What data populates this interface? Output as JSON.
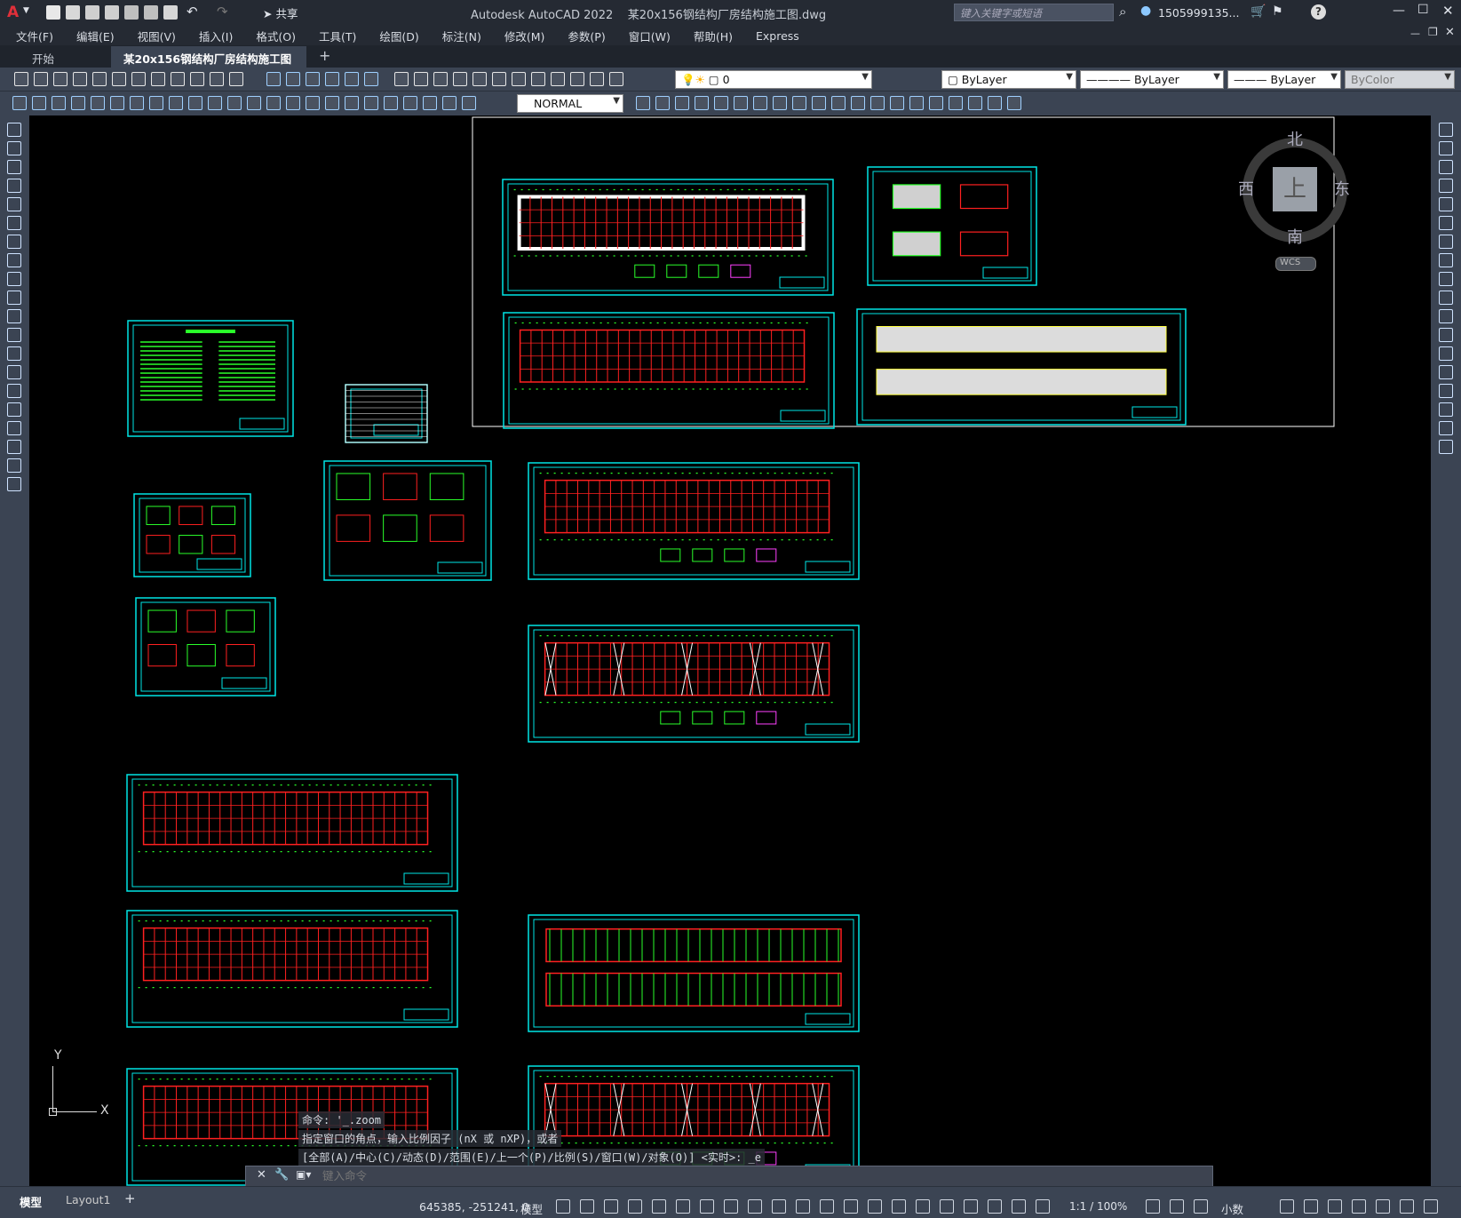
{
  "window": {
    "title": "Autodesk AutoCAD 2022    某20x156钢结构厂房结构施工图.dwg",
    "share_label": "共享",
    "search_placeholder": "键入关键字或短语",
    "user": "1505999135..."
  },
  "menu": [
    "文件(F)",
    "编辑(E)",
    "视图(V)",
    "插入(I)",
    "格式(O)",
    "工具(T)",
    "绘图(D)",
    "标注(N)",
    "修改(M)",
    "参数(P)",
    "窗口(W)",
    "帮助(H)",
    "Express"
  ],
  "tabs": [
    "开始",
    "某20x156钢结构厂房结构施工图*"
  ],
  "props": {
    "layer": "0",
    "color": "ByLayer",
    "linetype": "ByLayer",
    "lineweight": "ByLayer",
    "plotstyle": "ByColor",
    "dimstyle": "NORMAL"
  },
  "viewcube": {
    "north": "北",
    "south": "南",
    "east": "东",
    "west": "西",
    "top": "上",
    "wcs": "WCS"
  },
  "ucs": {
    "x": "X",
    "y": "Y"
  },
  "command": {
    "line1": "命令: '_.zoom",
    "line2": "指定窗口的角点，输入比例因子 (nX 或 nXP)，或者",
    "line3": "[全部(A)/中心(C)/动态(D)/范围(E)/上一个(P)/比例(S)/窗口(W)/对象(O)] <实时>: _e",
    "placeholder": "键入命令"
  },
  "status": {
    "model_tab": "模型",
    "layout_tab": "Layout1",
    "coords": "645385, -251241, 0",
    "space": "模型",
    "scale": "1:1 / 100%",
    "units": "小数"
  },
  "colors": {
    "frame": "#00e6e6",
    "grid": "#ff2020",
    "detail": "#2aff2a",
    "bg": "#000000"
  }
}
